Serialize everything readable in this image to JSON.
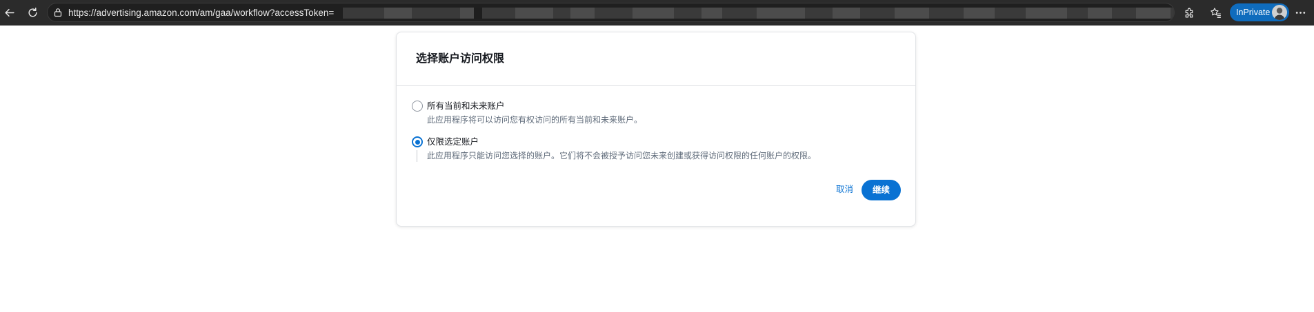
{
  "browser": {
    "url": "https://advertising.amazon.com/am/gaa/workflow?accessToken=",
    "url_truncation": "..",
    "inprivate_label": "InPrivate",
    "accent_color": "#0f6cbd"
  },
  "icons": {
    "back": "back-arrow-icon",
    "refresh": "refresh-icon",
    "site_info": "lock-icon",
    "favorite": "star-icon",
    "extensions": "puzzle-icon",
    "favorites_bar": "favorites-icon",
    "more": "more-icon"
  },
  "dialog": {
    "title": "选择账户访问权限",
    "options": [
      {
        "label": "所有当前和未来账户",
        "description": "此应用程序将可以访问您有权访问的所有当前和未来账户。",
        "selected": false
      },
      {
        "label": "仅限选定账户",
        "description": "此应用程序只能访问您选择的账户。它们将不会被授予访问您未来创建或获得访问权限的任何账户的权限。",
        "selected": true
      }
    ],
    "cancel_label": "取消",
    "continue_label": "继续",
    "primary_color": "#0972d3"
  }
}
